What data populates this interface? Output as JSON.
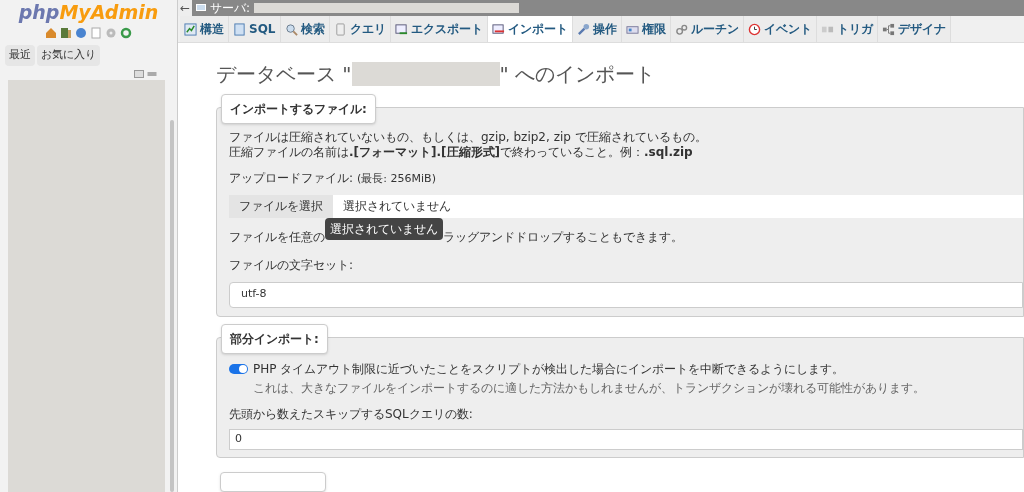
{
  "sidebar": {
    "logo": {
      "php": "php",
      "myadmin": "MyAdmin"
    },
    "tabs": [
      {
        "label": "最近",
        "selected": false
      },
      {
        "label": "お気に入り",
        "selected": false
      }
    ]
  },
  "topbar": {
    "back": "←",
    "server_label": "サーバ:"
  },
  "tabs": [
    {
      "label": "構造",
      "selected": false
    },
    {
      "label": "SQL",
      "selected": false
    },
    {
      "label": "検索",
      "selected": false
    },
    {
      "label": "クエリ",
      "selected": false
    },
    {
      "label": "エクスポート",
      "selected": false
    },
    {
      "label": "インポート",
      "selected": true
    },
    {
      "label": "操作",
      "selected": false
    },
    {
      "label": "権限",
      "selected": false
    },
    {
      "label": "ルーチン",
      "selected": false
    },
    {
      "label": "イベント",
      "selected": false
    },
    {
      "label": "トリガ",
      "selected": false
    },
    {
      "label": "デザイナ",
      "selected": false
    }
  ],
  "heading": {
    "before": "データベース \"",
    "after": "\" へのインポート"
  },
  "file_section": {
    "legend": "インポートするファイル:",
    "description": "ファイルは圧縮されていないもの、もしくは、gzip, bzip2, zip で圧縮されているもの。",
    "naming": "圧縮ファイルの名前は**.[フォーマット].[圧縮形式]**で終わっていること。例：**.sql.zip**",
    "upload_label": "アップロードファイル:",
    "upload_limit": "(最長: 256MiB)",
    "choose_button": "ファイルを選択",
    "chosen": "選択されていません",
    "tooltip": "選択されていません",
    "drop_hint_start": "ファイルを任意の",
    "drop_hint_end": "ラッグアンドドロップすることもできます。",
    "charset_label": "ファイルの文字セット:",
    "charset": "utf-8"
  },
  "partial_section": {
    "legend": "部分インポート:",
    "interrupt": {
      "label": "PHP タイムアウト制限に近づいたことをスクリプトが検出した場合にインポートを中断できるようにします。",
      "on": true
    },
    "note": "これは、大きなファイルをインポートするのに適した方法かもしれませんが、トランザクションが壊れる可能性があります。",
    "skip_label": "先頭から数えたスキップするSQLクエリの数:",
    "skip_value": "0"
  }
}
